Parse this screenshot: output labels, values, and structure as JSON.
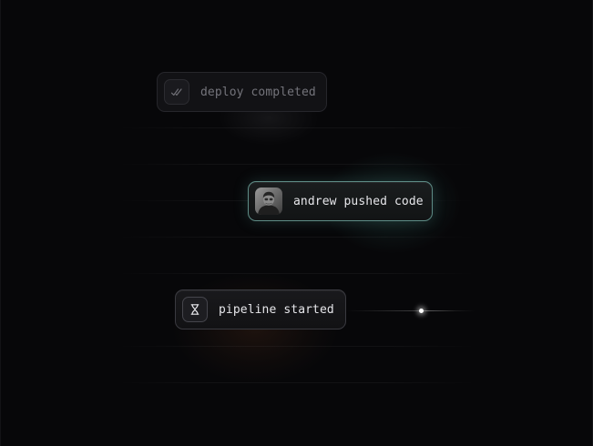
{
  "colors": {
    "background": "#070709",
    "accent_teal": "#5e8c86",
    "accent_orange": "#965028",
    "text_dim": "#74747b",
    "text_bright": "#e6e6ea"
  },
  "events": [
    {
      "label": "deploy completed",
      "icon": "double-check-icon",
      "state": "past"
    },
    {
      "label": "andrew pushed code",
      "icon": "avatar",
      "state": "active"
    },
    {
      "label": "pipeline started",
      "icon": "hourglass-icon",
      "state": "current"
    }
  ]
}
